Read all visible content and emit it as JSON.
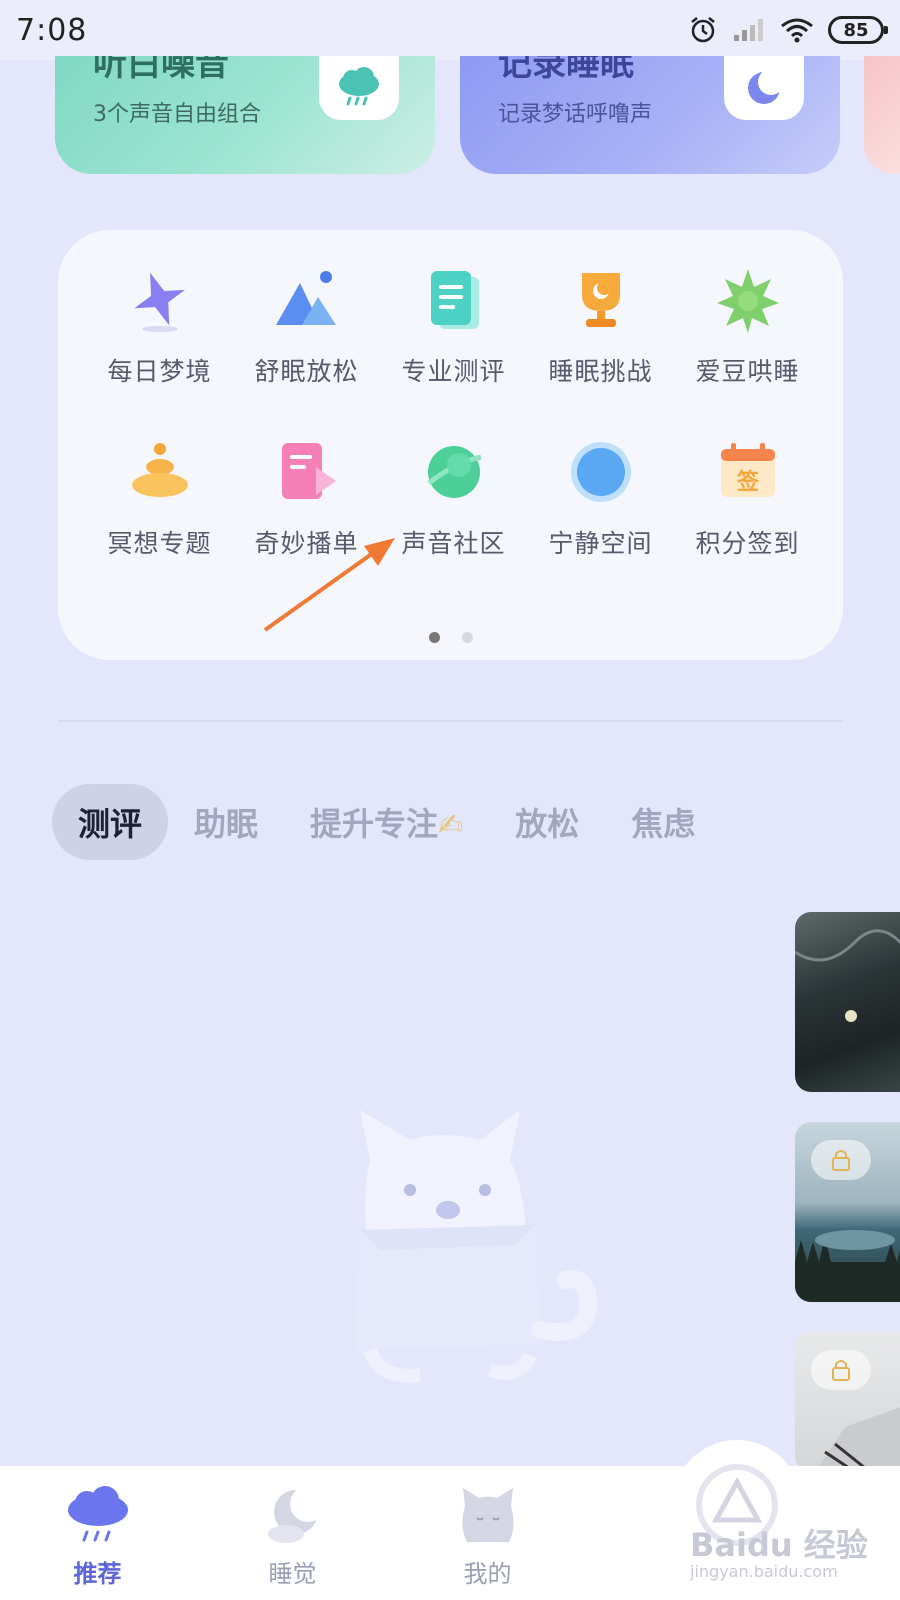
{
  "status_bar": {
    "time": "7:08",
    "battery": "85"
  },
  "top_cards": [
    {
      "title": "听白噪音",
      "subtitle": "3个声音自由组合",
      "icon": "cloud-rain-icon"
    },
    {
      "title": "记录睡眠",
      "subtitle": "记录梦话呼噜声",
      "icon": "moon-icon"
    }
  ],
  "grid": {
    "items": [
      {
        "label": "每日梦境",
        "icon": "star-icon"
      },
      {
        "label": "舒眠放松",
        "icon": "mountain-icon"
      },
      {
        "label": "专业测评",
        "icon": "document-icon"
      },
      {
        "label": "睡眠挑战",
        "icon": "trophy-icon"
      },
      {
        "label": "爱豆哄睡",
        "icon": "starburst-icon"
      },
      {
        "label": "冥想专题",
        "icon": "meditation-icon"
      },
      {
        "label": "奇妙播单",
        "icon": "playlist-icon"
      },
      {
        "label": "声音社区",
        "icon": "planet-icon"
      },
      {
        "label": "宁静空间",
        "icon": "orb-icon"
      },
      {
        "label": "积分签到",
        "icon": "calendar-icon"
      }
    ],
    "calendar_badge": "签",
    "pager": {
      "pages": 2,
      "current": 1
    }
  },
  "tabs": [
    {
      "label": "测评",
      "active": true
    },
    {
      "label": "助眠",
      "active": false
    },
    {
      "label": "提升专注",
      "active": false
    },
    {
      "label": "放松",
      "active": false
    },
    {
      "label": "焦虑",
      "active": false
    }
  ],
  "bottom_nav": [
    {
      "label": "推荐",
      "icon": "cloud-rain-icon",
      "active": true
    },
    {
      "label": "睡觉",
      "icon": "moon-cloud-icon",
      "active": false
    },
    {
      "label": "我的",
      "icon": "cat-face-icon",
      "active": false
    }
  ],
  "watermark": {
    "brand": "Baidu 经验",
    "url": "jingyan.baidu.com"
  },
  "colors": {
    "background": "#e4e6fb",
    "accent": "#5d66d8",
    "arrow": "#f07a33"
  }
}
